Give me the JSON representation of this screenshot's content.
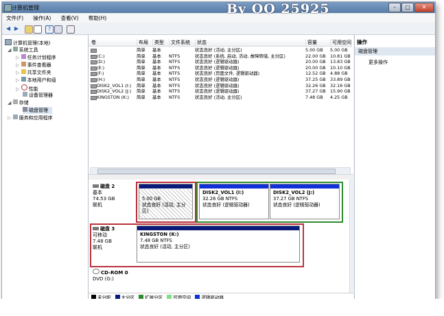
{
  "window": {
    "title": "计算机管理",
    "watermark": "By QQ 25925"
  },
  "menu": [
    "文件(F)",
    "操作(A)",
    "查看(V)",
    "帮助(H)"
  ],
  "tree": {
    "root": "计算机管理(本地)",
    "items": [
      {
        "label": "系统工具",
        "level": 1
      },
      {
        "label": "任务计划程序",
        "level": 2
      },
      {
        "label": "事件查看器",
        "level": 2
      },
      {
        "label": "共享文件夹",
        "level": 2
      },
      {
        "label": "本地用户和组",
        "level": 2
      },
      {
        "label": "性能",
        "level": 2
      },
      {
        "label": "设备管理器",
        "level": 2
      },
      {
        "label": "存储",
        "level": 1
      },
      {
        "label": "磁盘管理",
        "level": 2
      },
      {
        "label": "服务和应用程序",
        "level": 1
      }
    ]
  },
  "volumes": {
    "headers": [
      "卷",
      "布局",
      "类型",
      "文件系统",
      "状态",
      "容量",
      "可用空间"
    ],
    "rows": [
      [
        "",
        "简单",
        "基本",
        "",
        "状态良好 (活动, 主分区)",
        "5.00 GB",
        "5.00 GB"
      ],
      [
        "(C:)",
        "简单",
        "基本",
        "NTFS",
        "状态良好 (系统, 启动, 活动, 故障转储, 主分区)",
        "22.00 GB",
        "10.81 GB"
      ],
      [
        "(D:)",
        "简单",
        "基本",
        "NTFS",
        "状态良好 (逻辑驱动器)",
        "20.00 GB",
        "13.83 GB"
      ],
      [
        "(E:)",
        "简单",
        "基本",
        "NTFS",
        "状态良好 (逻辑驱动器)",
        "20.00 GB",
        "10.10 GB"
      ],
      [
        "(F:)",
        "简单",
        "基本",
        "NTFS",
        "状态良好 (页面文件, 逻辑驱动器)",
        "12.52 GB",
        "4.88 GB"
      ],
      [
        "(H:)",
        "简单",
        "基本",
        "NTFS",
        "状态良好 (逻辑驱动器)",
        "37.25 GB",
        "33.89 GB"
      ],
      [
        "DISK2_VOL1 (I:)",
        "简单",
        "基本",
        "NTFS",
        "状态良好 (逻辑驱动器)",
        "32.26 GB",
        "32.16 GB"
      ],
      [
        "DISK2_VOL2 (J:)",
        "简单",
        "基本",
        "NTFS",
        "状态良好 (逻辑驱动器)",
        "37.27 GB",
        "15.90 GB"
      ],
      [
        "KINGSTON (K:)",
        "简单",
        "基本",
        "NTFS",
        "状态良好 (活动, 主分区)",
        "7.48 GB",
        "4.25 GB"
      ]
    ]
  },
  "disks": {
    "disk2": {
      "name": "磁盘 2",
      "type": "基本",
      "size": "74.53 GB",
      "status": "联机",
      "p1": {
        "size": "5.00 GB",
        "status": "状态良好 (活动, 主分区)"
      },
      "p2": {
        "name": "DISK2_VOL1 (I:)",
        "size": "32.26 GB NTFS",
        "status": "状态良好 (逻辑驱动器)"
      },
      "p3": {
        "name": "DISK2_VOL2 (J:)",
        "size": "37.27 GB NTFS",
        "status": "状态良好 (逻辑驱动器)"
      }
    },
    "disk3": {
      "name": "磁盘 3",
      "type": "可移动",
      "size": "7.48 GB",
      "status": "联机",
      "p1": {
        "name": "KINGSTON (K:)",
        "size": "7.48 GB NTFS",
        "status": "状态良好 (活动, 主分区)"
      }
    },
    "cdrom": {
      "name": "CD-ROM 0",
      "drive": "DVD (G:)"
    }
  },
  "legend": [
    "未分配",
    "主分区",
    "扩展分区",
    "可用空间",
    "逻辑驱动器"
  ],
  "actions": {
    "title": "操作",
    "section": "磁盘管理",
    "more": "更多操作"
  }
}
